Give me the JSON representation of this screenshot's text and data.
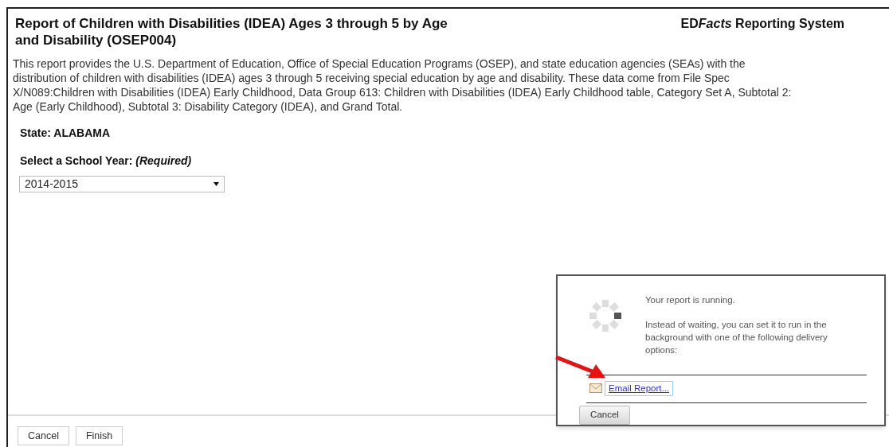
{
  "header": {
    "title": "Report of Children with Disabilities (IDEA) Ages 3 through 5 by Age and Disability (OSEP004)",
    "system": {
      "prefix": "ED",
      "italic": "Facts",
      "suffix": " Reporting System"
    }
  },
  "description": "This report provides the U.S. Department of Education, Office of Special Education Programs (OSEP), and state education agencies (SEAs) with the distribution of children with disabilities (IDEA) ages 3 through 5 receiving special education by age and disability. These data come from File Spec X/N089:Children with Disabilities (IDEA) Early Childhood, Data Group 613: Children with Disabilities (IDEA) Early Childhood table, Category Set A, Subtotal 2: Age (Early Childhood), Subtotal 3: Disability Category (IDEA), and Grand Total.",
  "state_label": "State: ALABAMA",
  "year_select": {
    "label": "Select a School Year: *(Required)*",
    "value": "2014-2015"
  },
  "footer_buttons": [
    "Cancel",
    "Finish"
  ],
  "dialog": {
    "message": "Your report is running.",
    "detail": "Instead of waiting, you can set it to run in the background with one of the following delivery options:",
    "link": "Email Report...",
    "cancel": "Cancel"
  }
}
